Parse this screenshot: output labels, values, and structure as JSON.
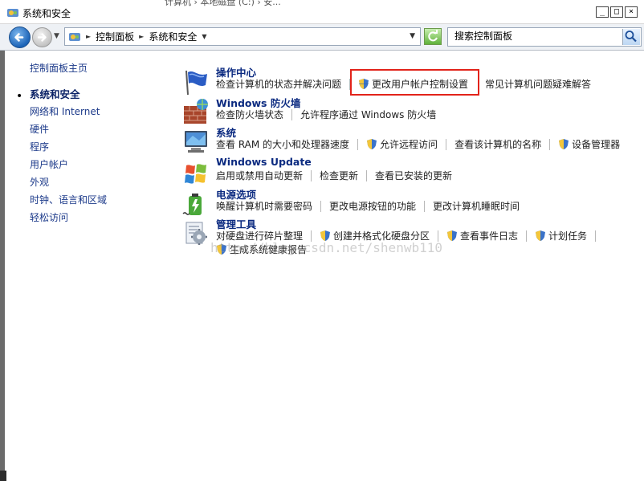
{
  "window": {
    "title": "系统和安全",
    "behind_text": "计算机 › 本地磁盘 (C:) › 安...",
    "minimize": "_",
    "maximize": "□",
    "close": "×"
  },
  "address": {
    "crumbs": [
      "控制面板",
      "系统和安全"
    ],
    "search_placeholder": "搜索控制面板"
  },
  "leftnav": {
    "items": [
      {
        "label": "控制面板主页",
        "current": false
      },
      {
        "label": "系统和安全",
        "current": true
      },
      {
        "label": "网络和 Internet",
        "current": false
      },
      {
        "label": "硬件",
        "current": false
      },
      {
        "label": "程序",
        "current": false
      },
      {
        "label": "用户帐户",
        "current": false
      },
      {
        "label": "外观",
        "current": false
      },
      {
        "label": "时钟、语言和区域",
        "current": false
      },
      {
        "label": "轻松访问",
        "current": false
      }
    ]
  },
  "sections": {
    "action_center": {
      "title": "操作中心",
      "link1": "检查计算机的状态并解决问题",
      "link2": "更改用户帐户控制设置",
      "link3": "常见计算机问题疑难解答"
    },
    "firewall": {
      "title": "Windows 防火墙",
      "link1": "检查防火墙状态",
      "link2": "允许程序通过 Windows 防火墙"
    },
    "system": {
      "title": "系统",
      "link1": "查看 RAM 的大小和处理器速度",
      "link2": "允许远程访问",
      "link3": "查看该计算机的名称",
      "link4": "设备管理器"
    },
    "update": {
      "title": "Windows Update",
      "link1": "启用或禁用自动更新",
      "link2": "检查更新",
      "link3": "查看已安装的更新"
    },
    "power": {
      "title": "电源选项",
      "link1": "唤醒计算机时需要密码",
      "link2": "更改电源按钮的功能",
      "link3": "更改计算机睡眠时间"
    },
    "admin": {
      "title": "管理工具",
      "link1": "对硬盘进行碎片整理",
      "link2": "创建并格式化硬盘分区",
      "link3": "查看事件日志",
      "link4": "计划任务",
      "link5": "生成系统健康报告"
    }
  },
  "watermark": "http://blog.csdn.net/shenwb110",
  "colors": {
    "highlight_border": "#e2231a",
    "section_title": "#0b2a80",
    "nav_link": "#1c3a8a"
  }
}
